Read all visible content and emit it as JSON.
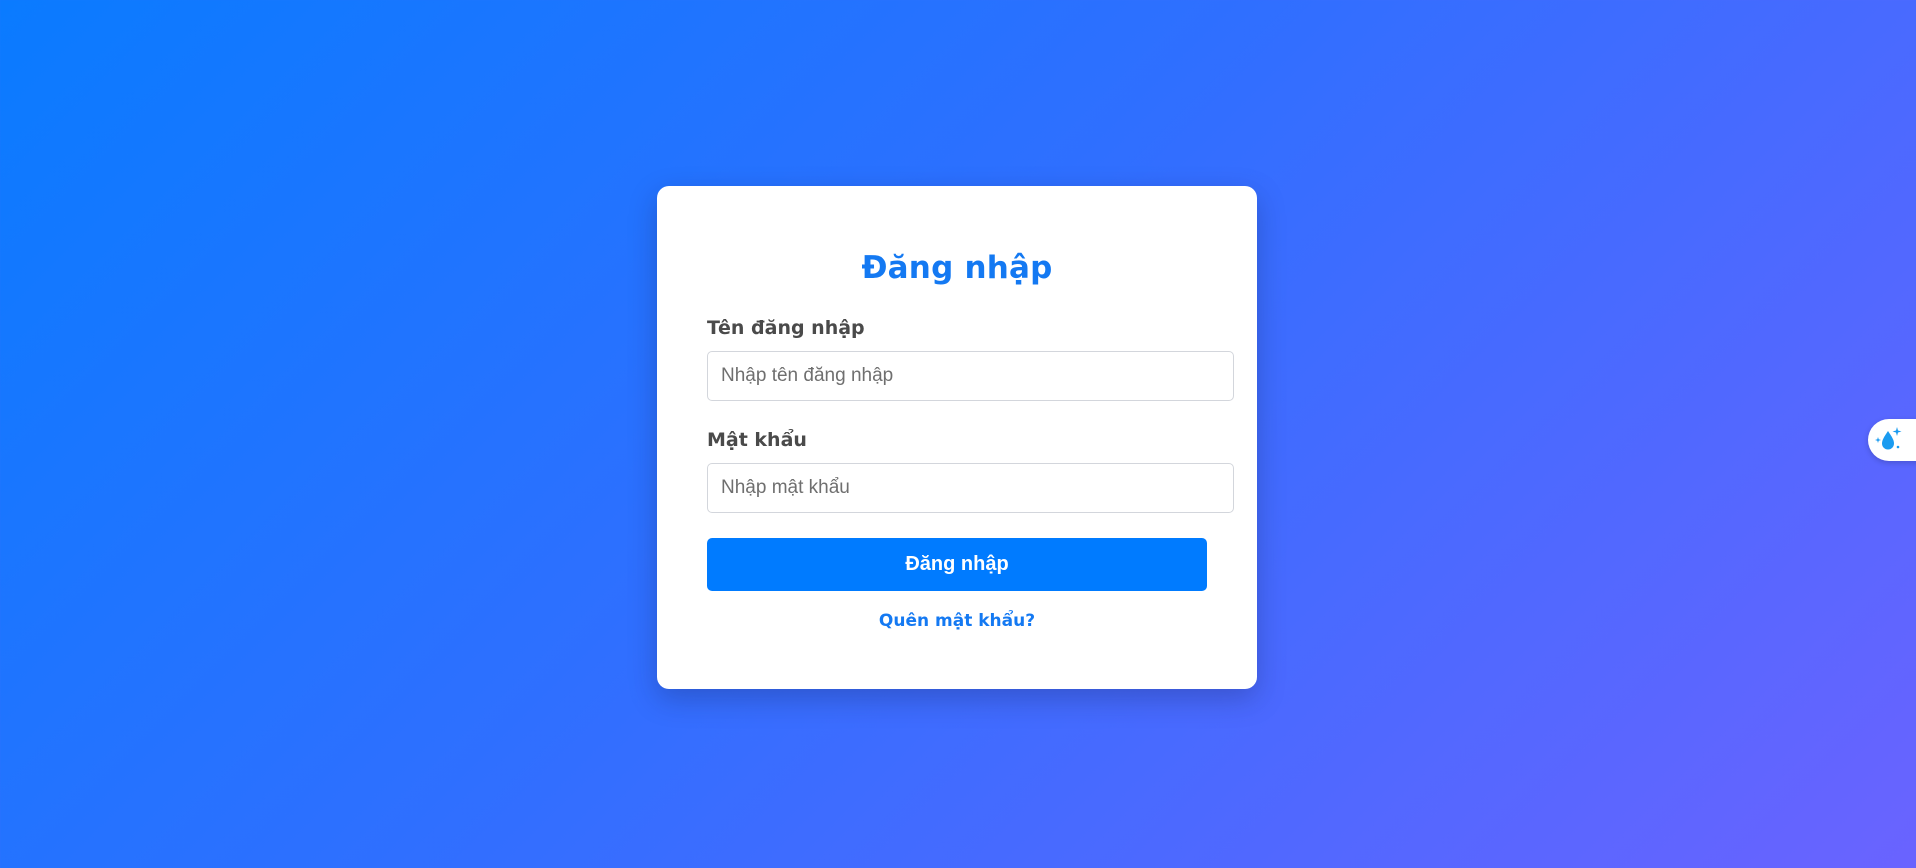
{
  "login": {
    "title": "Đăng nhập",
    "username_label": "Tên đăng nhập",
    "username_placeholder": "Nhập tên đăng nhập",
    "username_value": "",
    "password_label": "Mật khẩu",
    "password_placeholder": "Nhập mật khẩu",
    "password_value": "",
    "submit_label": "Đăng nhập",
    "forgot_link": "Quên mật khẩu?"
  },
  "extension": {
    "icon": "water-drop-sparkle-icon"
  },
  "colors": {
    "background_start": "#0a7bff",
    "background_end": "#6a63ff",
    "primary": "#007bff",
    "title": "#1479f2",
    "label": "#4a4a4a",
    "card": "#ffffff"
  }
}
